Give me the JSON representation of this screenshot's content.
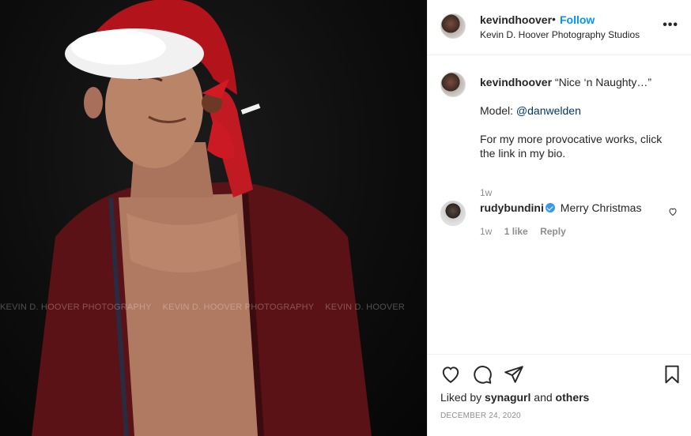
{
  "photo": {
    "watermark": [
      "KEVIN D. HOOVER PHOTOGRAPHY",
      "KEVIN D. HOOVER PHOTOGRAPHY",
      "KEVIN D. HOOVER"
    ]
  },
  "header": {
    "username": "kevindhoover",
    "separator": "•",
    "follow_label": "Follow",
    "location": "Kevin D. Hoover Photography Studios",
    "more_label": "•••"
  },
  "caption": {
    "username": "kevindhoover",
    "title": "“Nice ‘n Naughty…”",
    "model_prefix": "Model: ",
    "model_mention": "@danwelden",
    "body": "For my more provocative works, click the link in my bio.",
    "time": "1w"
  },
  "comment": {
    "username": "rudybundini",
    "text": "Merry Christmas",
    "time": "1w",
    "likes": "1 like",
    "reply_label": "Reply"
  },
  "actions": {
    "liked_by_prefix": "Liked by ",
    "liked_by_user": "synagurl",
    "liked_by_and": " and ",
    "liked_by_others": "others",
    "date": "DECEMBER 24, 2020"
  },
  "colors": {
    "accent": "#0095f6",
    "text": "#262626",
    "secondary": "#8e8e8e",
    "border": "#efefef",
    "verified": "#3897f0"
  },
  "icons": [
    "heart-icon",
    "comment-icon",
    "share-icon",
    "save-icon",
    "more-icon",
    "verified-icon"
  ]
}
